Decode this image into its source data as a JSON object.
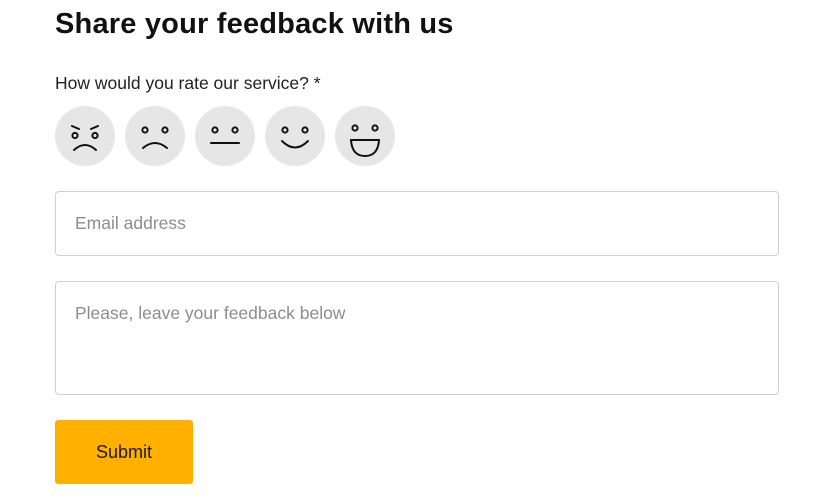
{
  "form": {
    "title": "Share your feedback with us",
    "rating_question": "How would you rate our service? *",
    "ratings": [
      {
        "icon": "very-dissatisfied-face-icon"
      },
      {
        "icon": "dissatisfied-face-icon"
      },
      {
        "icon": "neutral-face-icon"
      },
      {
        "icon": "satisfied-face-icon"
      },
      {
        "icon": "very-satisfied-face-icon"
      }
    ],
    "email_placeholder": "Email address",
    "email_value": "",
    "feedback_placeholder": "Please, leave your feedback below",
    "feedback_value": "",
    "submit_label": "Submit"
  },
  "colors": {
    "accent": "#ffb000",
    "face_background": "#e6e6e6",
    "input_border": "#cfcfcf",
    "placeholder": "#8d8d8d"
  }
}
